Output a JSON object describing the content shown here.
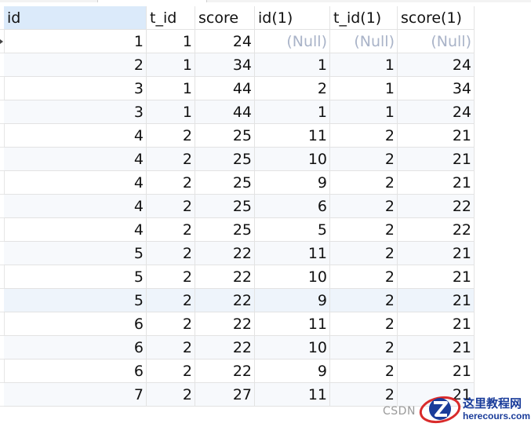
{
  "table": {
    "columns": [
      "id",
      "t_id",
      "score",
      "id(1)",
      "t_id(1)",
      "score(1)"
    ],
    "rows": [
      [
        "1",
        "1",
        "24",
        "(Null)",
        "(Null)",
        "(Null)"
      ],
      [
        "2",
        "1",
        "34",
        "1",
        "1",
        "24"
      ],
      [
        "3",
        "1",
        "44",
        "2",
        "1",
        "34"
      ],
      [
        "3",
        "1",
        "44",
        "1",
        "1",
        "24"
      ],
      [
        "4",
        "2",
        "25",
        "11",
        "2",
        "21"
      ],
      [
        "4",
        "2",
        "25",
        "10",
        "2",
        "21"
      ],
      [
        "4",
        "2",
        "25",
        "9",
        "2",
        "21"
      ],
      [
        "4",
        "2",
        "25",
        "6",
        "2",
        "22"
      ],
      [
        "4",
        "2",
        "25",
        "5",
        "2",
        "22"
      ],
      [
        "5",
        "2",
        "22",
        "11",
        "2",
        "21"
      ],
      [
        "5",
        "2",
        "22",
        "10",
        "2",
        "21"
      ],
      [
        "5",
        "2",
        "22",
        "9",
        "2",
        "21"
      ],
      [
        "6",
        "2",
        "22",
        "11",
        "2",
        "21"
      ],
      [
        "6",
        "2",
        "22",
        "10",
        "2",
        "21"
      ],
      [
        "6",
        "2",
        "22",
        "9",
        "2",
        "21"
      ],
      [
        "7",
        "2",
        "27",
        "11",
        "2",
        "21"
      ]
    ],
    "active_column": 0,
    "current_row": 0
  },
  "watermark": {
    "csdn": "CSDN",
    "site_cn": "这里教程网",
    "site_en": "herecours.com",
    "logo_icon": "z-logo-icon",
    "brand_color": "#1a3c9a",
    "accent_color": "#d92b2b"
  }
}
